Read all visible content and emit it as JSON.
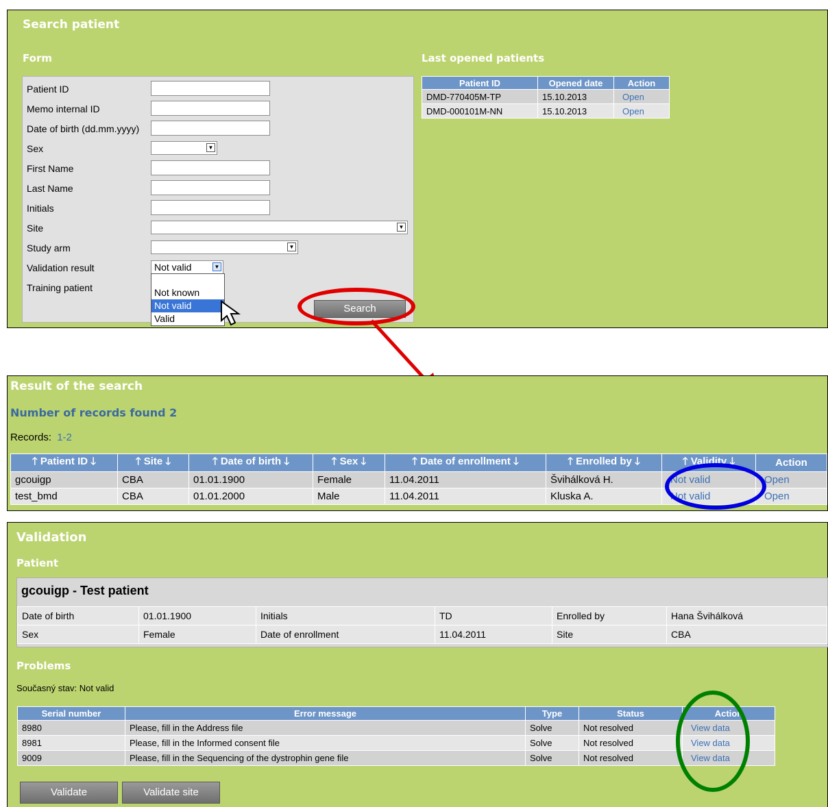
{
  "search": {
    "title": "Search patient",
    "form_heading": "Form",
    "labels": [
      "Patient ID",
      "Memo internal ID",
      "Date of birth (dd.mm.yyyy)",
      "Sex",
      "First Name",
      "Last Name",
      "Initials",
      "Site",
      "Study arm",
      "Validation result",
      "Training patient"
    ],
    "validation_value": "Not valid",
    "dropdown_options": [
      "Not known",
      "Not valid",
      "Valid"
    ],
    "search_button": "Search",
    "last_opened": {
      "heading": "Last opened patients",
      "headers": [
        "Patient ID",
        "Opened date",
        "Action"
      ],
      "rows": [
        [
          "DMD-770405M-TP",
          "15.10.2013",
          "Open"
        ],
        [
          "DMD-000101M-NN",
          "15.10.2013",
          "Open"
        ]
      ]
    }
  },
  "results": {
    "title": "Result of the search",
    "count": "Number of records found 2",
    "records_label": "Records:",
    "records_range": "1-2",
    "headers": [
      "Patient ID",
      "Site",
      "Date of birth",
      "Sex",
      "Date of enrollment",
      "Enrolled by",
      "Validity",
      "Action"
    ],
    "rows": [
      [
        "gcouigp",
        "CBA",
        "01.01.1900",
        "Female",
        "11.04.2011",
        "Švihálková H.",
        "Not valid",
        "Open"
      ],
      [
        "test_bmd",
        "CBA",
        "01.01.2000",
        "Male",
        "11.04.2011",
        "Kluska A.",
        "Not valid",
        "Open"
      ]
    ]
  },
  "validation": {
    "title": "Validation",
    "patient_heading": "Patient",
    "patient_name": "gcouigp - Test patient",
    "info": [
      [
        "Date of birth",
        "01.01.1900",
        "Initials",
        "TD",
        "Enrolled by",
        "Hana Švihálková"
      ],
      [
        "Sex",
        "Female",
        "Date of enrollment",
        "11.04.2011",
        "Site",
        "CBA"
      ]
    ],
    "problems_heading": "Problems",
    "state": "Současný stav: Not valid",
    "headers": [
      "Serial number",
      "Error message",
      "Type",
      "Status",
      "Action"
    ],
    "rows": [
      [
        "8980",
        "Please, fill in the Address file",
        "Solve",
        "Not resolved",
        "View data"
      ],
      [
        "8981",
        "Please, fill in the Informed consent file",
        "Solve",
        "Not resolved",
        "View data"
      ],
      [
        "9009",
        "Please, fill in the Sequencing of the dystrophin gene file",
        "Solve",
        "Not resolved",
        "View data"
      ]
    ],
    "validate_button": "Validate",
    "validate_site_button": "Validate site"
  },
  "colors": {
    "panel": "#bcd46f",
    "header": "#6d95c8",
    "annotation_red": "#e00000",
    "annotation_blue": "#0000e0",
    "annotation_green": "#008000"
  }
}
